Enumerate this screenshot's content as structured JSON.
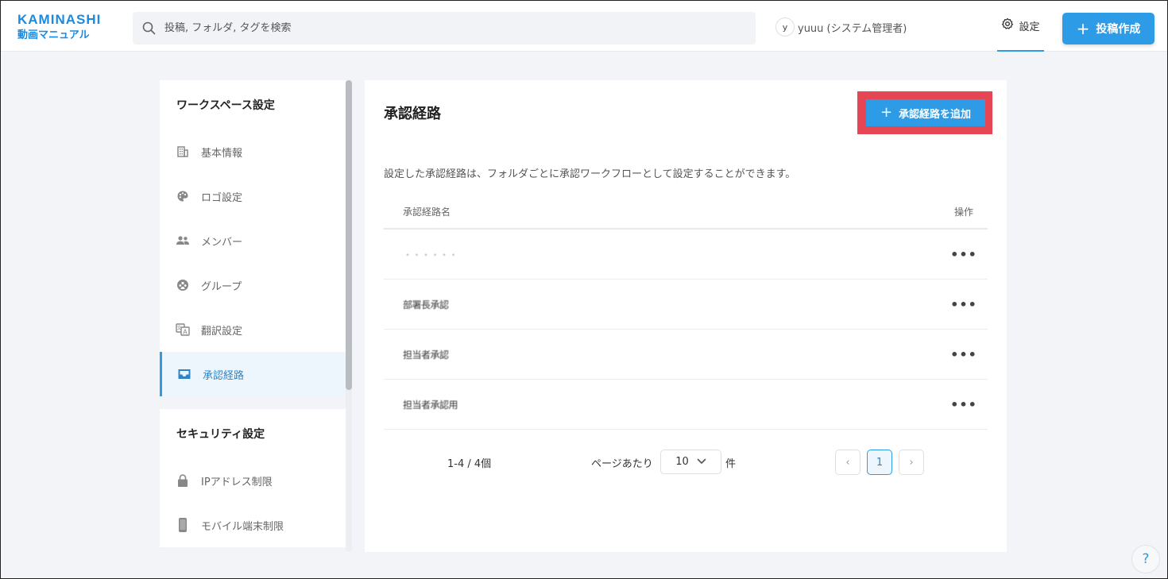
{
  "header": {
    "logo_top": "KAMINASHI",
    "logo_sub": "動画マニュアル",
    "search_placeholder": "投稿, フォルダ, タグを検索",
    "avatar_letter": "y",
    "user_name": "yuuu (システム管理者)",
    "settings_label": "設定",
    "post_button_label": "投稿作成"
  },
  "sidebar": {
    "workspace_heading": "ワークスペース設定",
    "workspace_items": [
      {
        "label": "基本情報",
        "icon": "building-icon"
      },
      {
        "label": "ロゴ設定",
        "icon": "palette-icon"
      },
      {
        "label": "メンバー",
        "icon": "people-icon"
      },
      {
        "label": "グループ",
        "icon": "group-icon"
      },
      {
        "label": "翻訳設定",
        "icon": "translate-icon"
      },
      {
        "label": "承認経路",
        "icon": "inbox-icon",
        "active": true
      }
    ],
    "security_heading": "セキュリティ設定",
    "security_items": [
      {
        "label": "IPアドレス制限",
        "icon": "lock-icon"
      },
      {
        "label": "モバイル端末制限",
        "icon": "mobile-icon"
      }
    ]
  },
  "main": {
    "title": "承認経路",
    "add_button_label": "承認経路を追加",
    "description": "設定した承認経路は、フォルダごとに承認ワークフローとして設定することができます。",
    "columns": [
      "承認経路名",
      "操作"
    ],
    "rows": [
      {
        "name": "・・・・・・",
        "action": "•••"
      },
      {
        "name": "部署長承認",
        "action": "•••"
      },
      {
        "name": "担当者承認",
        "action": "•••"
      },
      {
        "name": "担当者承認用",
        "action": "•••"
      }
    ],
    "pagination": {
      "range": "1-4 / 4個",
      "per_page_label": "ページあたり",
      "per_page_value": "10",
      "per_page_unit": "件",
      "current_page": "1",
      "prev": "‹",
      "next": "›"
    }
  },
  "help_label": "?",
  "colors": {
    "accent": "#2d9be6",
    "highlight": "#e64553"
  }
}
